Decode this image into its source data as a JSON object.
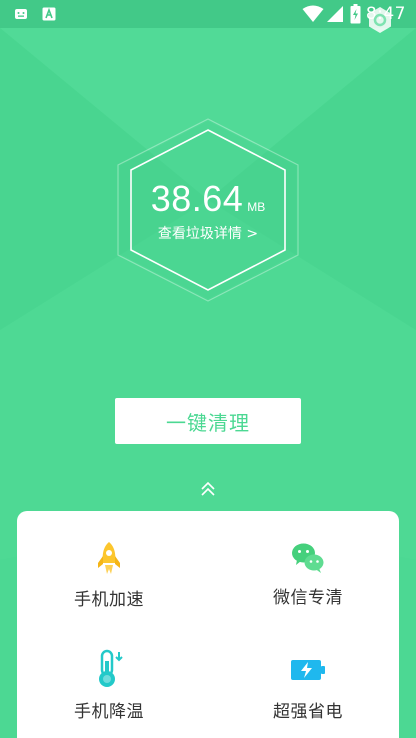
{
  "status_bar": {
    "time": "8:47",
    "icons": [
      "notification-icon",
      "android-a-icon",
      "wifi-icon",
      "cellular-signal-icon",
      "battery-charging-icon"
    ]
  },
  "summary": {
    "size_value": "38.64",
    "size_unit": "MB",
    "detail_link": "查看垃圾详情 >"
  },
  "actions": {
    "clean_label": "一键清理"
  },
  "tools": [
    {
      "label": "手机加速",
      "icon": "rocket-icon",
      "color": "#fcc62d"
    },
    {
      "label": "微信专清",
      "icon": "wechat-icon",
      "color": "#45d07c"
    },
    {
      "label": "手机降温",
      "icon": "thermometer-icon",
      "color": "#23c9c9"
    },
    {
      "label": "超强省电",
      "icon": "battery-charge-icon",
      "color": "#1fb8ee"
    }
  ],
  "colors": {
    "background": "#4cd893",
    "status_bar": "#42c988",
    "panel": "#ffffff",
    "accent": "#4cd893"
  }
}
